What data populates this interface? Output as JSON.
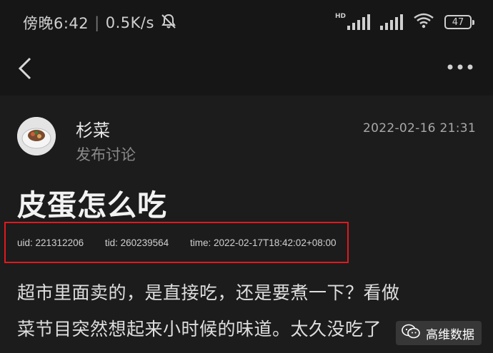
{
  "status_bar": {
    "time": "傍晚6:42",
    "speed": "0.5K/s",
    "hd_label": "HD",
    "battery": "47"
  },
  "post": {
    "username": "杉菜",
    "action": "发布讨论",
    "time": "2022-02-16 21:31",
    "title": "皮蛋怎么吃",
    "meta": {
      "uid": "uid: 221312206",
      "tid": "tid: 260239564",
      "timestamp": "time: 2022-02-17T18:42:02+08:00"
    },
    "body_lines": [
      "超市里面卖的，是直接吃，还是要煮一下？看做",
      "菜节目突然想起来小时候的味道。太久没吃了"
    ]
  },
  "watermark": {
    "label": "高维数据"
  },
  "colors": {
    "background": "#1c1c1c",
    "highlight_box": "#e0191f",
    "secondary_text": "#8a8a8a"
  }
}
